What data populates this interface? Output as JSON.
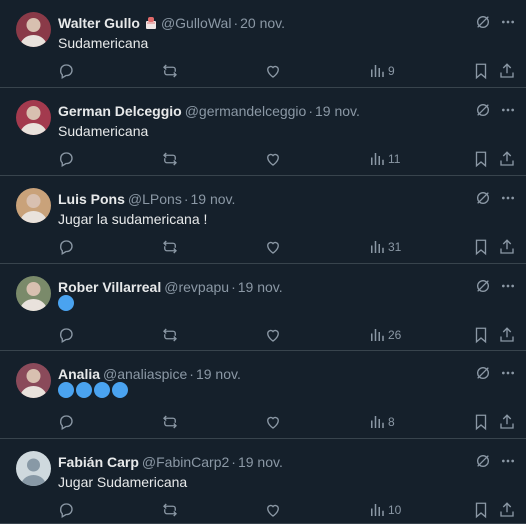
{
  "posts": [
    {
      "name": "Walter Gullo",
      "handle": "@GulloWal",
      "date": "20 nov.",
      "text": "Sudamericana",
      "views": "9",
      "has_badge": true,
      "blue_dots": 0,
      "avatar": "#8a3a48"
    },
    {
      "name": "German Delceggio",
      "handle": "@germandelceggio",
      "date": "19 nov.",
      "text": "Sudamericana",
      "views": "11",
      "has_badge": false,
      "blue_dots": 0,
      "avatar": "#a33a4e"
    },
    {
      "name": "Luis Pons",
      "handle": "@LPons",
      "date": "19 nov.",
      "text": "Jugar la sudamericana !",
      "views": "31",
      "has_badge": false,
      "blue_dots": 0,
      "avatar": "#c9a27a"
    },
    {
      "name": "Rober Villarreal",
      "handle": "@revpapu",
      "date": "19 nov.",
      "text": "",
      "views": "26",
      "has_badge": false,
      "blue_dots": 1,
      "avatar": "#7a8a6a"
    },
    {
      "name": "Analia",
      "handle": "@analiaspice",
      "date": "19 nov.",
      "text": "",
      "views": "8",
      "has_badge": false,
      "blue_dots": 4,
      "avatar": "#8a4a5a"
    },
    {
      "name": "Fabián Carp",
      "handle": "@FabinCarp2",
      "date": "19 nov.",
      "text": "Jugar Sudamericana",
      "views": "10",
      "has_badge": false,
      "blue_dots": 0,
      "avatar": "#cfd9de"
    }
  ],
  "separator": "·",
  "colors": {
    "background": "#15202b",
    "muted": "#8b98a5",
    "emoji_blue": "#4aa3f0",
    "border": "#38444d"
  },
  "icons": [
    "grok-icon",
    "more-icon",
    "reply-icon",
    "repost-icon",
    "like-icon",
    "views-icon",
    "bookmark-icon",
    "share-icon"
  ]
}
